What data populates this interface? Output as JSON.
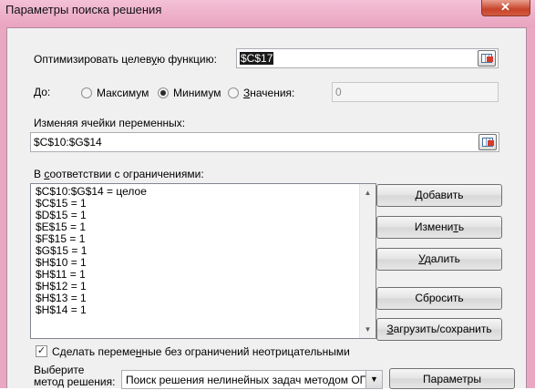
{
  "window": {
    "title": "Параметры поиска решения",
    "close_glyph": "✕"
  },
  "objective": {
    "label_before": "Оптимизировать целев",
    "label_ul": "у",
    "label_after": "ю функцию:",
    "value": "$C$17"
  },
  "goal": {
    "label": "До:",
    "options": [
      {
        "label": "Максимум",
        "ul": "",
        "rest": "Максимум",
        "selected": false
      },
      {
        "label": "Минимум",
        "ul": "",
        "rest": "Минимум",
        "selected": true
      },
      {
        "label": "Значения:",
        "ul": "З",
        "rest": "начения:",
        "selected": false
      }
    ],
    "value_field": "0"
  },
  "variables": {
    "label": "Изменяя ячейки переменных:",
    "value": "$C$10:$G$14"
  },
  "constraints": {
    "label_pre": "В ",
    "label_ul": "с",
    "label_post": "оответствии с ограничениями:",
    "items": [
      "$C$10:$G$14 = целое",
      "$C$15 = 1",
      "$D$15 = 1",
      "$E$15 = 1",
      "$F$15 = 1",
      "$G$15 = 1",
      "$H$10 = 1",
      "$H$11 = 1",
      "$H$12 = 1",
      "$H$13 = 1",
      "$H$14 = 1"
    ],
    "scroll_up": "▲",
    "scroll_down": "▼"
  },
  "buttons": {
    "add": {
      "ul": "Д",
      "rest": "обавить"
    },
    "change_pre": "Измени",
    "change_ul": "т",
    "change_post": "ь",
    "delete": {
      "ul": "У",
      "rest": "далить"
    },
    "reset": "Сбросить",
    "load_pre": "",
    "load_ul": "З",
    "load_post": "агрузить/сохранить",
    "params": "Параметры"
  },
  "nonnegative": {
    "checked": true,
    "check_glyph": "✓",
    "label_pre": "С",
    "label_ul": "д",
    "label_mid": "елать переме",
    "label_ul2": "н",
    "label_post": "ные без ограничений неотрицательными"
  },
  "method": {
    "label_line1": "Выберите",
    "label_line2": "метод решения:",
    "selected": "Поиск решения нелинейных задач методом ОПГ",
    "dropdown_glyph": "▼"
  }
}
